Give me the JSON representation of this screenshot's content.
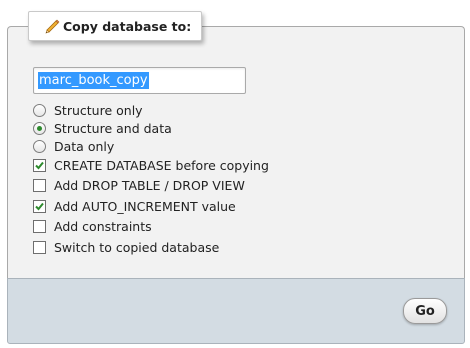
{
  "legend": {
    "title": "Copy database to:",
    "icon": "pencil-icon"
  },
  "database_name": {
    "value": "marc_book_copy"
  },
  "mode_options": [
    {
      "label": "Structure only",
      "selected": false
    },
    {
      "label": "Structure and data",
      "selected": true
    },
    {
      "label": "Data only",
      "selected": false
    }
  ],
  "checkbox_options": [
    {
      "label": "CREATE DATABASE before copying",
      "checked": true
    },
    {
      "label": "Add DROP TABLE / DROP VIEW",
      "checked": false
    },
    {
      "label": "Add AUTO_INCREMENT value",
      "checked": true
    },
    {
      "label": "Add constraints",
      "checked": false
    },
    {
      "label": "Switch to copied database",
      "checked": false
    }
  ],
  "footer": {
    "go_label": "Go"
  },
  "colors": {
    "panel_bg": "#f2f2f2",
    "footer_bg": "#d3dce3",
    "selection": "#3399ff",
    "check_green": "#2d8a2d"
  }
}
